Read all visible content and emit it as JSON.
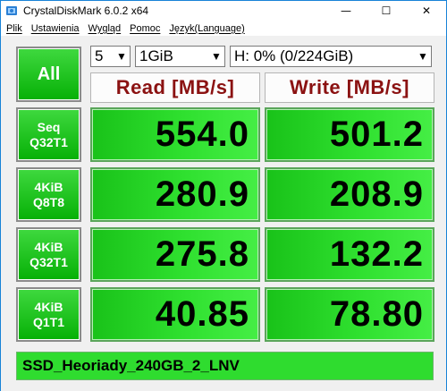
{
  "window": {
    "title": "CrystalDiskMark 6.0.2 x64",
    "minimize": "—",
    "maximize": "☐",
    "close": "✕"
  },
  "menu": [
    "Plik",
    "Ustawienia",
    "Wygląd",
    "Pomoc",
    "Język(Language)"
  ],
  "controls": {
    "all_label": "All",
    "count": "5",
    "size": "1GiB",
    "drive": "H: 0% (0/224GiB)"
  },
  "headers": {
    "read": "Read [MB/s]",
    "write": "Write [MB/s]"
  },
  "tests": [
    {
      "line1": "Seq",
      "line2": "Q32T1",
      "read": "554.0",
      "write": "501.2"
    },
    {
      "line1": "4KiB",
      "line2": "Q8T8",
      "read": "280.9",
      "write": "208.9"
    },
    {
      "line1": "4KiB",
      "line2": "Q32T1",
      "read": "275.8",
      "write": "132.2"
    },
    {
      "line1": "4KiB",
      "line2": "Q1T1",
      "read": "40.85",
      "write": "78.80"
    }
  ],
  "comment": "SSD_Heoriady_240GB_2_LNV",
  "colors": {
    "accent_green": "#2fdc2f",
    "header_text": "#8b1212",
    "window_border": "#1883d7"
  }
}
